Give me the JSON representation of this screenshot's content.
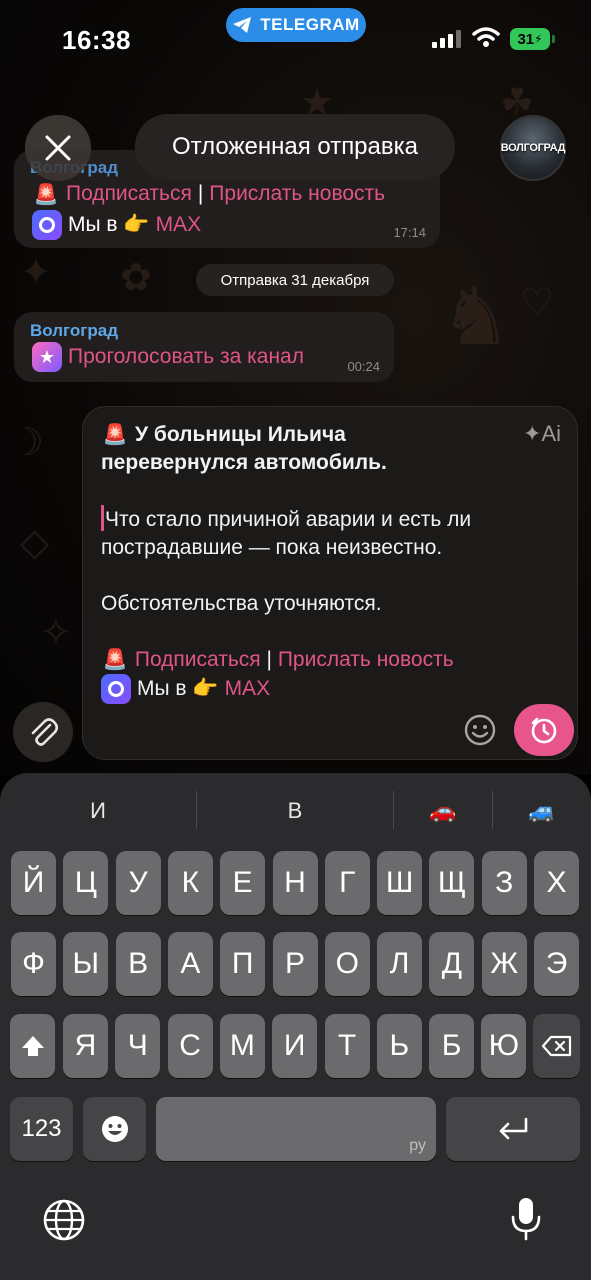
{
  "status_bar": {
    "time": "16:38",
    "app_pill": "TELEGRAM",
    "battery": "31"
  },
  "header": {
    "title": "Отложенная отправка",
    "avatar_label": "ВОЛГОГРАД"
  },
  "messages": {
    "first": {
      "sender": "Волгоград",
      "subscribe": "Подписаться",
      "separator": "|",
      "send_news": "Прислать новость",
      "we_in": "Мы в 👉",
      "max": "MAX",
      "time": "17:14"
    },
    "date_separator": "Отправка 31 декабря",
    "second": {
      "sender": "Волгоград",
      "vote": "Проголосовать за канал",
      "time": "00:24"
    }
  },
  "composer": {
    "title_line1": "У больницы Ильича",
    "title_line2": "перевернулся автомобиль.",
    "para1": "Что стало причиной аварии и есть ли пострадавшие — пока неизвестно.",
    "para2": "Обстоятельства уточняются.",
    "subscribe": "Подписаться",
    "separator": "|",
    "send_news": "Прислать новость",
    "we_in": "Мы в 👉",
    "max": "MAX",
    "ai_label": "Ai"
  },
  "keyboard": {
    "suggestions": [
      "И",
      "В",
      "🚗",
      "🚙"
    ],
    "row1": [
      "Й",
      "Ц",
      "У",
      "К",
      "Е",
      "Н",
      "Г",
      "Ш",
      "Щ",
      "З",
      "Х"
    ],
    "row2": [
      "Ф",
      "Ы",
      "В",
      "А",
      "П",
      "Р",
      "О",
      "Л",
      "Д",
      "Ж",
      "Э"
    ],
    "row3": [
      "Я",
      "Ч",
      "С",
      "М",
      "И",
      "Т",
      "Ь",
      "Б",
      "Ю"
    ],
    "numbers_key": "123",
    "space_lang": "ру"
  },
  "colors": {
    "accent": "#e8558a",
    "link": "#e0548a",
    "sender": "#5fa8e8",
    "telegram": "#2b8de8"
  }
}
